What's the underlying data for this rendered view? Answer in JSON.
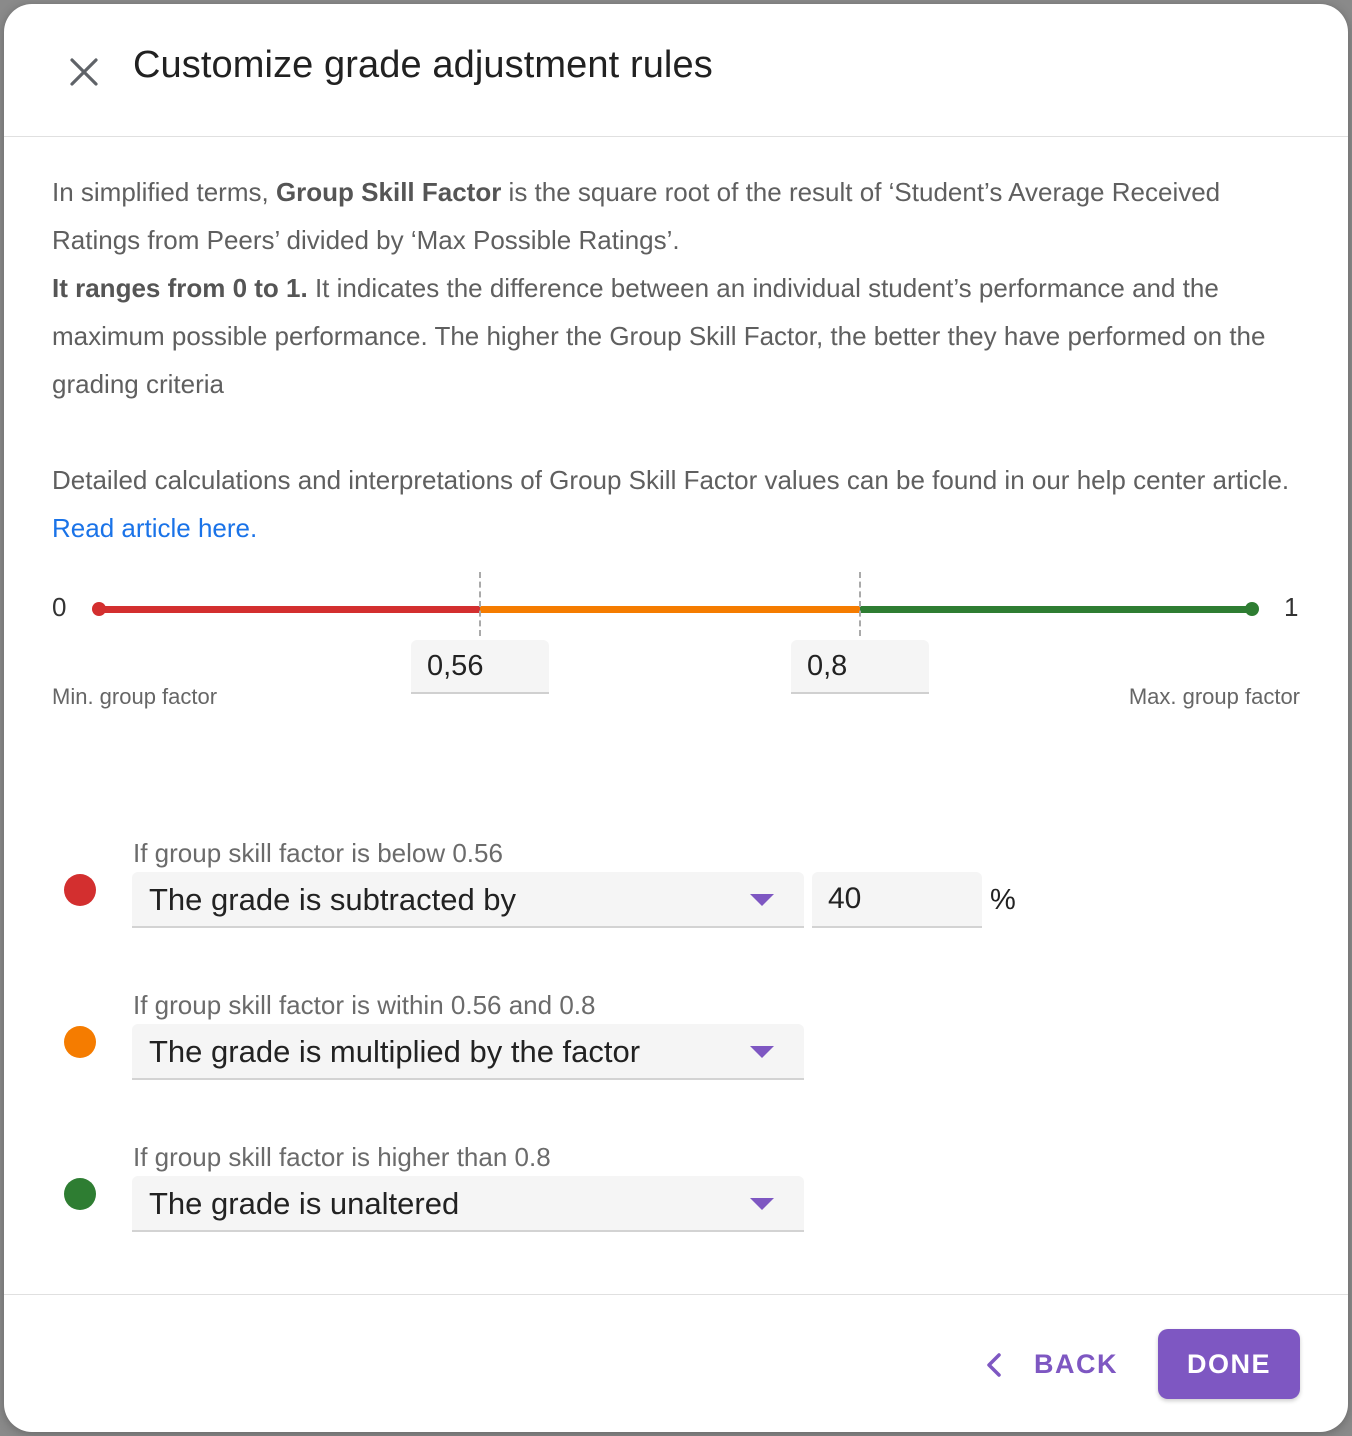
{
  "dialog": {
    "title": "Customize grade adjustment rules"
  },
  "intro": {
    "p1_pre": "In simplified terms, ",
    "p1_bold": "Group Skill Factor",
    "p1_post": " is the square root of the result of ‘Student’s Average Received Ratings from Peers’ divided by ‘Max Possible Ratings’.",
    "p2_bold": "It ranges from 0 to 1.",
    "p2_post": " It indicates the difference between an individual student’s performance and the maximum possible performance. The higher the Group Skill Factor, the better they have performed on the grading criteria",
    "p3_pre": "Detailed calculations and interpretations of Group Skill Factor values can be found in our help center article. ",
    "p3_link": "Read article here."
  },
  "scale": {
    "min_value": "0",
    "max_value": "1",
    "min_caption": "Min. group factor",
    "max_caption": "Max. group factor",
    "threshold_low": "0,56",
    "threshold_high": "0,8",
    "colors": {
      "red": "#d32f2f",
      "orange": "#f57c00",
      "green": "#2e7d32"
    }
  },
  "rules": [
    {
      "label": "If group skill factor is below 0.56",
      "selected": "The grade is subtracted by",
      "value": "40",
      "unit": "%"
    },
    {
      "label": "If group skill factor is within 0.56 and 0.8",
      "selected": "The grade is multiplied by the factor"
    },
    {
      "label": "If group skill factor is higher than 0.8",
      "selected": "The grade is unaltered"
    }
  ],
  "footer": {
    "back_label": "BACK",
    "done_label": "DONE"
  },
  "accent": "#7e57c2"
}
